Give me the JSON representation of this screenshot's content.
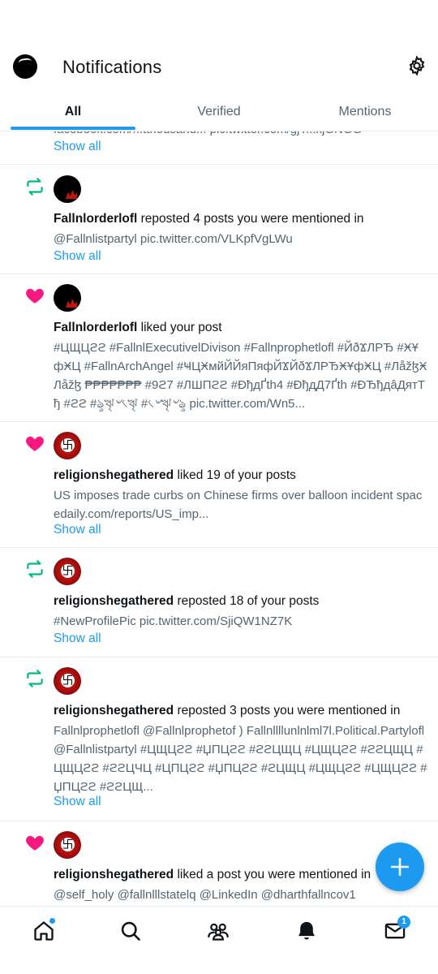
{
  "header": {
    "title": "Notifications"
  },
  "tabs": [
    {
      "label": "All"
    },
    {
      "label": "Verified"
    },
    {
      "label": "Mentions"
    }
  ],
  "top_partial": {
    "cut_text": "facebook.com/...tthousand... pic.twitter.com/gjT...xjGNGG",
    "show_all": "Show all"
  },
  "notifications": [
    {
      "kind": "repost",
      "user": "Fallnlorderlofl",
      "action": " reposted 4 posts you were mentioned in",
      "body": "@Fallnlistpartyl pic.twitter.com/VLKpfVgLWu",
      "show_all": "Show all"
    },
    {
      "kind": "like",
      "user": "Fallnlorderlofl",
      "action": " liked your post",
      "body": "#ЦЩЦϩϩ #FallnlExecutivelDivison #Fallnprophetlofl #ЙðϪЛΡЂ #ӾҰфӾЦ #FallnArchAngel #ҸЦӾмйЙЙяПяфЙϪЙðϪЛΡЂӾҰфӾЦ #ЛåžɮӾЛåžɮ ₱₱₱₱₱₱₱ #9ϩ7 #ЛШПϩϩ #ÐђдҐth4 #ÐђдД7Ґth #ÐЂђдâДятТђ #ϩϩ #ৡৠ৺৻ৠ #৻৺ৠ৺ৡ pic.twitter.com/Wn5...",
      "show_all": ""
    },
    {
      "kind": "like",
      "user": "religionshegathered",
      "action": " liked 19 of your posts",
      "body": "US imposes trade curbs on Chinese firms over balloon incident spacedaily.com/reports/US_imp...",
      "show_all": "Show all"
    },
    {
      "kind": "repost",
      "user": "religionshegathered",
      "action": " reposted 18 of your posts",
      "body": "#NewProfilePic pic.twitter.com/SjiQW1NZ7K",
      "show_all": "Show all"
    },
    {
      "kind": "repost",
      "user": "religionshegathered",
      "action": " reposted 3 posts you were mentioned in",
      "body": "Fallnlprophetlofl @Fallnlprophetof ) Fallnllllunlnlml7l.Political.Partylofl @Fallnlistpartyl  #ЦЩЦϩϩ #ЏПЦϩϩ #ϩϩЦЩЦ #ЦЩЦϩϩ #ϩϩЦЩЦ #ЦЩЦϩϩ #ϩϩЦЧЦ #ЦПЦϩϩ #ЏПЦϩϩ #ϩЦЩЦ #ЦЩЦϩϩ #ЦЩЦϩϩ #ЏПЦϩϩ #ϩϩЦЩ...",
      "show_all": "Show all"
    },
    {
      "kind": "like",
      "user": "religionshegathered",
      "action": " liked a post you were mentioned in",
      "body": "@self_holy @fallnlllstatelq @LinkedIn @dharthfallncov1",
      "show_all": ""
    }
  ],
  "nav": {
    "items": [
      "home-icon",
      "search-icon",
      "communities-icon",
      "notifications-icon",
      "messages-icon"
    ],
    "messages_badge": "1"
  },
  "colors": {
    "accent": "#1d9bf0",
    "repost": "#00ba7c",
    "like": "#f91880"
  }
}
